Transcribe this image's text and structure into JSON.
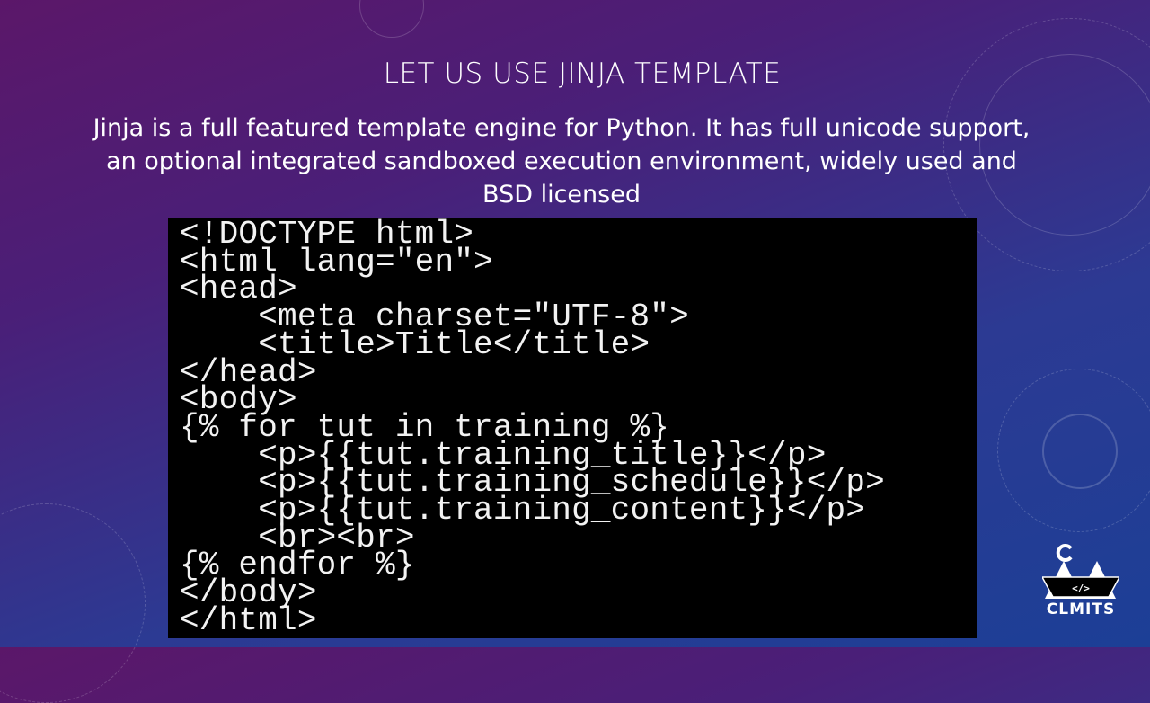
{
  "slide": {
    "title": "LET US USE JINJA TEMPLATE",
    "subtitle_lines": [
      "Jinja is a full featured template engine for Python. It has full unicode support,",
      "an optional integrated sandboxed execution environment, widely used and",
      "BSD licensed"
    ],
    "code": "<!DOCTYPE html>\n<html lang=\"en\">\n<head>\n    <meta charset=\"UTF-8\">\n    <title>Title</title>\n</head>\n<body>\n{% for tut in training %}\n    <p>{{tut.training_title}}</p>\n    <p>{{tut.training_schedule}}</p>\n    <p>{{tut.training_content}}</p>\n    <br><br>\n{% endfor %}\n</body>\n</html>",
    "logo": {
      "text": "CLMITS",
      "badge": "</>"
    }
  },
  "colors": {
    "bg_top": "#5b1769",
    "bg_bottom": "#1c3f96",
    "code_bg": "#000000"
  }
}
